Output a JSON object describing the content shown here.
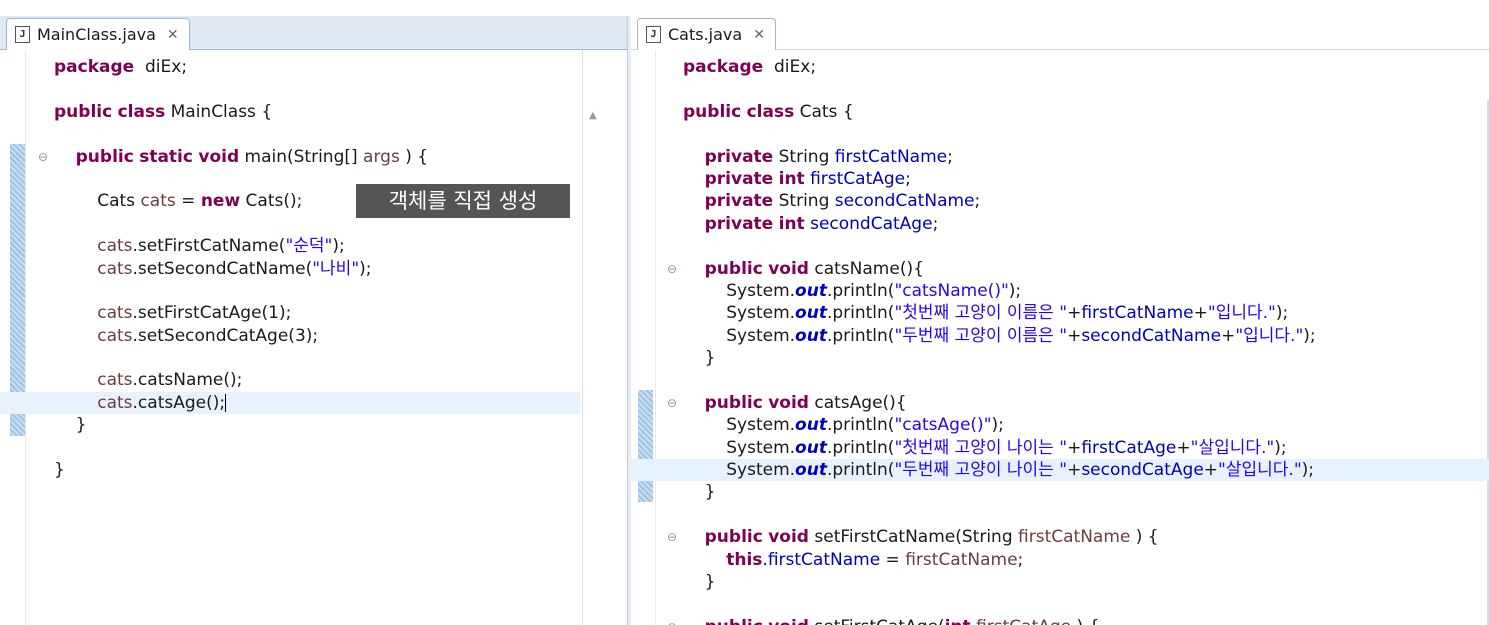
{
  "left_pane": {
    "tab": {
      "icon": "java-file-icon",
      "label": "MainClass.java",
      "close": "close-icon"
    },
    "annotation": "객체를 직접 생성",
    "lines": [
      [
        [
          "kw",
          "package"
        ],
        [
          "",
          "  diEx;"
        ]
      ],
      [],
      [
        [
          "kw",
          "public"
        ],
        [
          "",
          " "
        ],
        [
          "kw",
          "class"
        ],
        [
          "",
          " MainClass {"
        ]
      ],
      [],
      [
        [
          "",
          "    "
        ],
        [
          "kw",
          "public"
        ],
        [
          "",
          " "
        ],
        [
          "kw",
          "static"
        ],
        [
          "",
          " "
        ],
        [
          "kw",
          "void"
        ],
        [
          "",
          " main(String[] "
        ],
        [
          "var",
          "args"
        ],
        [
          "",
          " ) {"
        ]
      ],
      [],
      [
        [
          "",
          "        Cats "
        ],
        [
          "var",
          "cats"
        ],
        [
          "",
          " = "
        ],
        [
          "kw",
          "new"
        ],
        [
          "",
          " Cats();"
        ]
      ],
      [],
      [
        [
          "",
          "        "
        ],
        [
          "var",
          "cats"
        ],
        [
          "",
          ".setFirstCatName("
        ],
        [
          "str",
          "\"순덕\""
        ],
        [
          "",
          ");"
        ]
      ],
      [
        [
          "",
          "        "
        ],
        [
          "var",
          "cats"
        ],
        [
          "",
          ".setSecondCatName("
        ],
        [
          "str",
          "\"나비\""
        ],
        [
          "",
          ");"
        ]
      ],
      [],
      [
        [
          "",
          "        "
        ],
        [
          "var",
          "cats"
        ],
        [
          "",
          ".setFirstCatAge(1);"
        ]
      ],
      [
        [
          "",
          "        "
        ],
        [
          "var",
          "cats"
        ],
        [
          "",
          ".setSecondCatAge(3);"
        ]
      ],
      [],
      [
        [
          "",
          "        "
        ],
        [
          "var",
          "cats"
        ],
        [
          "",
          ".catsName();"
        ]
      ],
      [
        [
          "",
          "        "
        ],
        [
          "var",
          "cats"
        ],
        [
          "",
          ".catsAge();"
        ]
      ],
      [
        [
          "",
          "    }"
        ]
      ],
      [],
      [
        [
          "",
          "}"
        ]
      ]
    ]
  },
  "right_pane": {
    "tab": {
      "icon": "java-file-icon",
      "label": "Cats.java",
      "close": "close-icon"
    },
    "lines": [
      [
        [
          "kw",
          "package"
        ],
        [
          "",
          "  diEx;"
        ]
      ],
      [],
      [
        [
          "kw",
          "public"
        ],
        [
          "",
          " "
        ],
        [
          "kw",
          "class"
        ],
        [
          "",
          " Cats {"
        ]
      ],
      [],
      [
        [
          "",
          "    "
        ],
        [
          "kw",
          "private"
        ],
        [
          "",
          " String "
        ],
        [
          "fld",
          "firstCatName"
        ],
        [
          "",
          ";"
        ]
      ],
      [
        [
          "",
          "    "
        ],
        [
          "kw",
          "private"
        ],
        [
          "",
          " "
        ],
        [
          "kw",
          "int"
        ],
        [
          "",
          " "
        ],
        [
          "fld",
          "firstCatAge"
        ],
        [
          "",
          ";"
        ]
      ],
      [
        [
          "",
          "    "
        ],
        [
          "kw",
          "private"
        ],
        [
          "",
          " String "
        ],
        [
          "fld",
          "secondCatName"
        ],
        [
          "",
          ";"
        ]
      ],
      [
        [
          "",
          "    "
        ],
        [
          "kw",
          "private"
        ],
        [
          "",
          " "
        ],
        [
          "kw",
          "int"
        ],
        [
          "",
          " "
        ],
        [
          "fld",
          "secondCatAge"
        ],
        [
          "",
          ";"
        ]
      ],
      [],
      [
        [
          "",
          "    "
        ],
        [
          "kw",
          "public"
        ],
        [
          "",
          " "
        ],
        [
          "kw",
          "void"
        ],
        [
          "",
          " catsName(){"
        ]
      ],
      [
        [
          "",
          "        System."
        ],
        [
          "stfld",
          "out"
        ],
        [
          "",
          ".println("
        ],
        [
          "str",
          "\"catsName()\""
        ],
        [
          "",
          ");"
        ]
      ],
      [
        [
          "",
          "        System."
        ],
        [
          "stfld",
          "out"
        ],
        [
          "",
          ".println("
        ],
        [
          "str",
          "\"첫번째 고양이 이름은 \""
        ],
        [
          "",
          "+"
        ],
        [
          "fld",
          "firstCatName"
        ],
        [
          "",
          "+"
        ],
        [
          "str",
          "\"입니다.\""
        ],
        [
          "",
          ");"
        ]
      ],
      [
        [
          "",
          "        System."
        ],
        [
          "stfld",
          "out"
        ],
        [
          "",
          ".println("
        ],
        [
          "str",
          "\"두번째 고양이 이름은 \""
        ],
        [
          "",
          "+"
        ],
        [
          "fld",
          "secondCatName"
        ],
        [
          "",
          "+"
        ],
        [
          "str",
          "\"입니다.\""
        ],
        [
          "",
          ");"
        ]
      ],
      [
        [
          "",
          "    }"
        ]
      ],
      [],
      [
        [
          "",
          "    "
        ],
        [
          "kw",
          "public"
        ],
        [
          "",
          " "
        ],
        [
          "kw",
          "void"
        ],
        [
          "",
          " catsAge(){"
        ]
      ],
      [
        [
          "",
          "        System."
        ],
        [
          "stfld",
          "out"
        ],
        [
          "",
          ".println("
        ],
        [
          "str",
          "\"catsAge()\""
        ],
        [
          "",
          ");"
        ]
      ],
      [
        [
          "",
          "        System."
        ],
        [
          "stfld",
          "out"
        ],
        [
          "",
          ".println("
        ],
        [
          "str",
          "\"첫번째 고양이 나이는 \""
        ],
        [
          "",
          "+"
        ],
        [
          "fld",
          "firstCatAge"
        ],
        [
          "",
          "+"
        ],
        [
          "str",
          "\"살입니다.\""
        ],
        [
          "",
          ");"
        ]
      ],
      [
        [
          "",
          "        System."
        ],
        [
          "stfld",
          "out"
        ],
        [
          "",
          ".println("
        ],
        [
          "str",
          "\"두번째 고양이 나이는 \""
        ],
        [
          "",
          "+"
        ],
        [
          "fld",
          "secondCatAge"
        ],
        [
          "",
          "+"
        ],
        [
          "str",
          "\"살입니다.\""
        ],
        [
          "",
          ");"
        ]
      ],
      [
        [
          "",
          "    }"
        ]
      ],
      [],
      [
        [
          "",
          "    "
        ],
        [
          "kw",
          "public"
        ],
        [
          "",
          " "
        ],
        [
          "kw",
          "void"
        ],
        [
          "",
          " setFirstCatName(String "
        ],
        [
          "var",
          "firstCatName"
        ],
        [
          "",
          " ) {"
        ]
      ],
      [
        [
          "",
          "        "
        ],
        [
          "kw",
          "this"
        ],
        [
          "",
          "."
        ],
        [
          "fld",
          "firstCatName"
        ],
        [
          "",
          " = "
        ],
        [
          "var",
          "firstCatName"
        ],
        [
          "",
          ";"
        ]
      ],
      [
        [
          "",
          "    }"
        ]
      ],
      [],
      [
        [
          "",
          "    "
        ],
        [
          "kw",
          "public"
        ],
        [
          "",
          " "
        ],
        [
          "kw",
          "void"
        ],
        [
          "",
          " setFirstCatAge("
        ],
        [
          "kw",
          "int"
        ],
        [
          "",
          " "
        ],
        [
          "var",
          "firstCatAge"
        ],
        [
          "",
          " ) {"
        ]
      ]
    ]
  },
  "colors": {
    "keyword": "#7f0055",
    "string": "#2a00ff",
    "field": "#0000c0",
    "local_var": "#6a3e3e",
    "current_line": "#e8f2fe",
    "tab_bar": "#dfe9f6",
    "annotation_bg": "#555555"
  }
}
